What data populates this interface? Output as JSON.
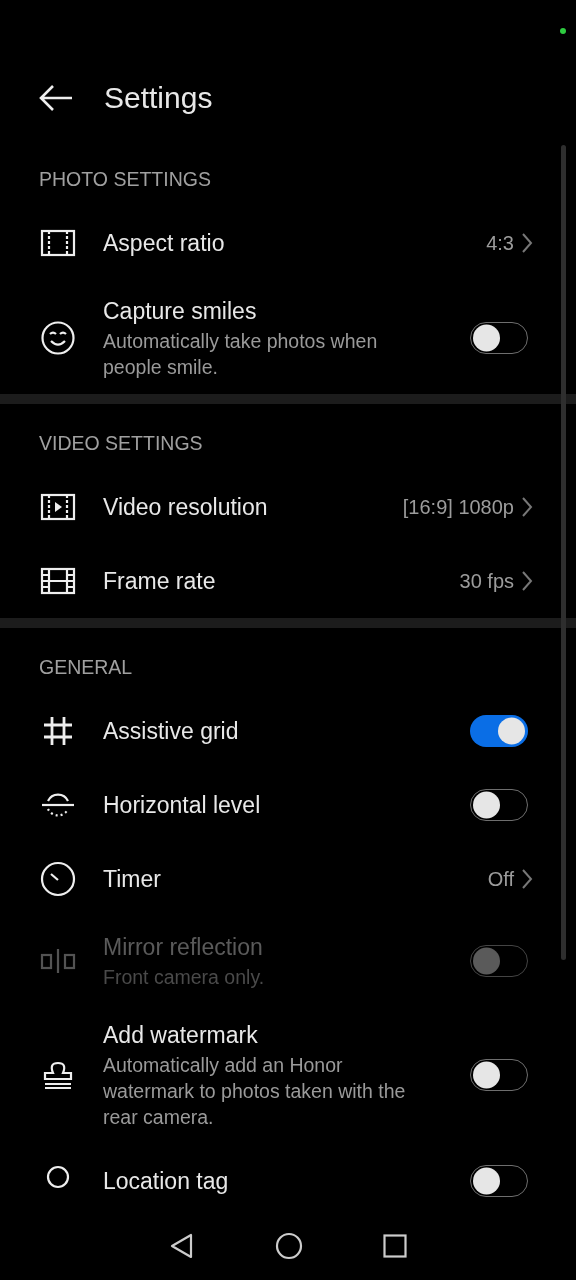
{
  "header": {
    "title": "Settings"
  },
  "sections": [
    {
      "title": "PHOTO SETTINGS",
      "rows": [
        {
          "kind": "link",
          "title": "Aspect ratio",
          "value": "4:3"
        },
        {
          "kind": "toggle",
          "title": "Capture smiles",
          "description": "Automatically take photos when people smile.",
          "on": false,
          "disabled": false
        }
      ]
    },
    {
      "title": "VIDEO SETTINGS",
      "rows": [
        {
          "kind": "link",
          "title": "Video resolution",
          "value": "[16:9] 1080p"
        },
        {
          "kind": "link",
          "title": "Frame rate",
          "value": "30 fps"
        }
      ]
    },
    {
      "title": "GENERAL",
      "rows": [
        {
          "kind": "toggle",
          "title": "Assistive grid",
          "on": true,
          "disabled": false
        },
        {
          "kind": "toggle",
          "title": "Horizontal level",
          "on": false,
          "disabled": false
        },
        {
          "kind": "link",
          "title": "Timer",
          "value": "Off"
        },
        {
          "kind": "toggle",
          "title": "Mirror reflection",
          "description": "Front camera only.",
          "on": false,
          "disabled": true
        },
        {
          "kind": "toggle",
          "title": "Add watermark",
          "description": "Automatically add an Honor watermark to photos taken with the rear camera.",
          "on": false,
          "disabled": false
        },
        {
          "kind": "toggle",
          "title": "Location tag",
          "on": false,
          "disabled": false
        }
      ]
    }
  ]
}
